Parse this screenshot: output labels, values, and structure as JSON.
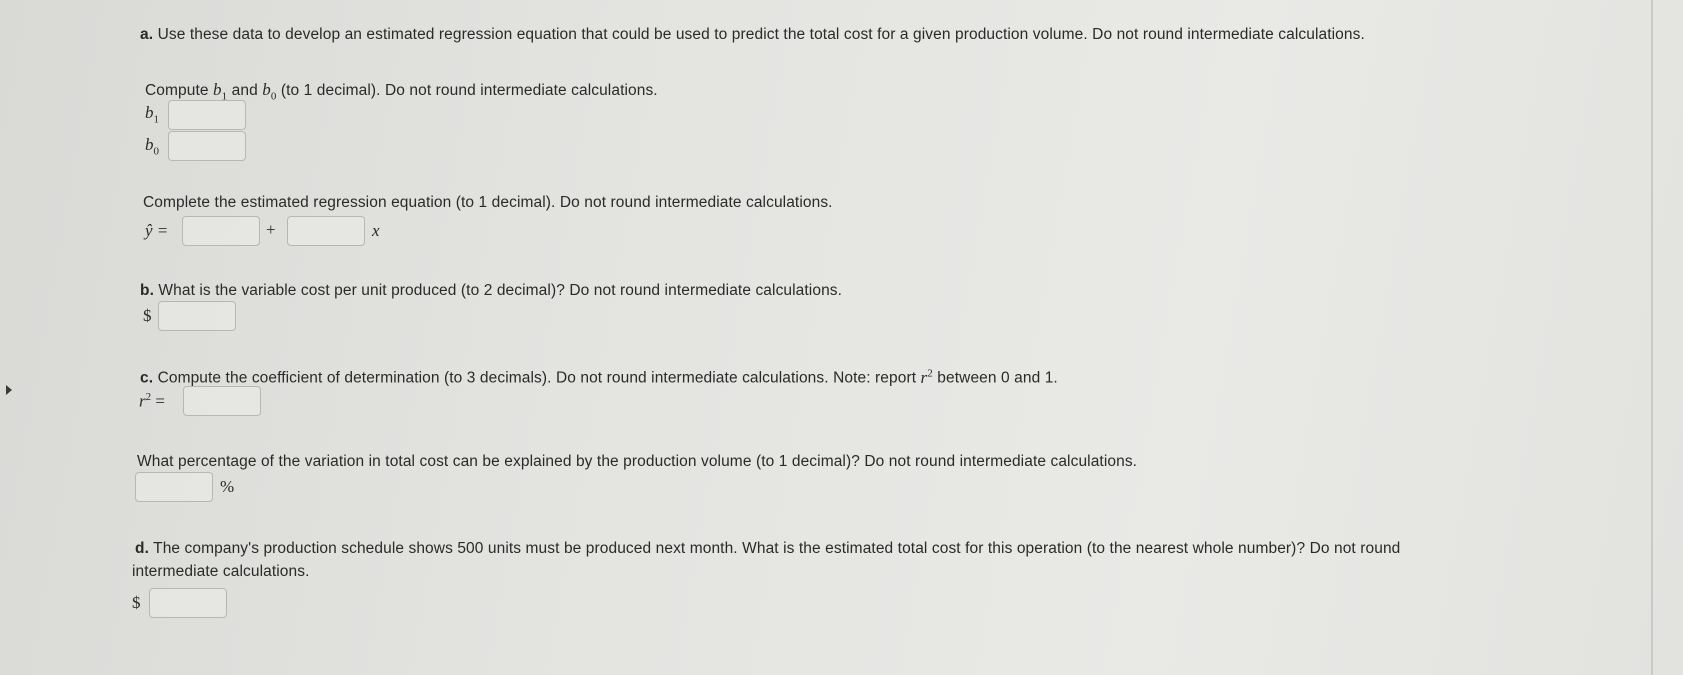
{
  "part_a": {
    "letter": "a.",
    "intro": "Use these data to develop an estimated regression equation that could be used to predict the total cost for a given production volume. Do not round intermediate calculations.",
    "compute_pre": "Compute",
    "compute_and": "and",
    "compute_post": "(to 1 decimal). Do not round intermediate calculations.",
    "b1_label": "b",
    "b1_sub": "1",
    "b0_label": "b",
    "b0_sub": "0",
    "equation_prompt": "Complete the estimated regression equation (to 1 decimal). Do not round intermediate calculations.",
    "yhat": "ŷ =",
    "plus": "+",
    "x": "x"
  },
  "part_b": {
    "letter": "b.",
    "prompt": "What is the variable cost per unit produced (to 2 decimal)? Do not round intermediate calculations.",
    "currency": "$"
  },
  "part_c": {
    "letter": "c.",
    "prompt_pre": "Compute the coefficient of determination (to 3 decimals). Do not round intermediate calculations. Note: report",
    "r": "r",
    "sup": "2",
    "prompt_post": "between 0 and 1.",
    "r2_label": "r",
    "r2_sup": "2",
    "equals": "=",
    "percentage_prompt": "What percentage of the variation in total cost can be explained by the production volume (to 1 decimal)? Do not round intermediate calculations.",
    "percent": "%"
  },
  "part_d": {
    "letter": "d.",
    "prompt_line1": "The company's production schedule shows 500 units must be produced next month. What is the estimated total cost for this operation (to the nearest whole number)? Do not round",
    "prompt_line2": "intermediate calculations.",
    "currency": "$"
  },
  "inputs": {
    "b1": "",
    "b0": "",
    "eq_intercept": "",
    "eq_slope": "",
    "variable_cost": "",
    "r2": "",
    "percentage": "",
    "total_cost": ""
  }
}
